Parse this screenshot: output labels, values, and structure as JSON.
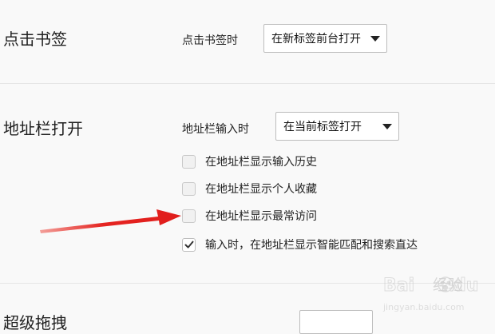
{
  "bookmark_section": {
    "title": "点击书签",
    "label": "点击书签时",
    "select_value": "在新标签前台打开"
  },
  "address_section": {
    "title": "地址栏打开",
    "label": "地址栏输入时",
    "select_value": "在当前标签打开",
    "options": [
      {
        "label": "在地址栏显示输入历史",
        "checked": false
      },
      {
        "label": "在地址栏显示个人收藏",
        "checked": false
      },
      {
        "label": "在地址栏显示最常访问",
        "checked": false
      },
      {
        "label": "输入时，在地址栏显示智能匹配和搜索直达",
        "checked": true
      }
    ]
  },
  "drag_section": {
    "title": "超级拖拽"
  },
  "watermark": {
    "brand": "Bai",
    "brand_suffix": "du",
    "cn": "经验",
    "url": "jingyan.baidu.com"
  },
  "colors": {
    "arrow": "#e52421",
    "checkmark": "#333333"
  }
}
